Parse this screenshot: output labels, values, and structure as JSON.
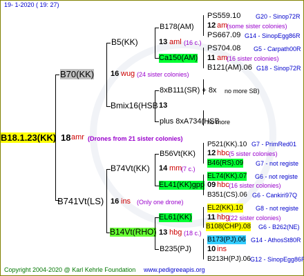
{
  "header": {
    "date": "19-  1-2020  ( 19:  27)"
  },
  "root": {
    "label": "B18.1.23(KK)",
    "num": "18",
    "src": "amr",
    "note": "(Drones from 21 sister colonies)"
  },
  "g1": [
    {
      "label": "B70(KK)",
      "num": "16",
      "src": "wug",
      "note": "(24 sister colonies)"
    },
    {
      "label": "B741Vt(LS)",
      "num": "16",
      "src": "ins",
      "note": "(Only one drone)"
    }
  ],
  "g2": [
    {
      "label": "B5(KK)",
      "num": "13",
      "src": "aml",
      "note": "(16 c.)"
    },
    {
      "label": "Bmix16(HSB",
      "num": "13",
      "src": "",
      "note": ""
    },
    {
      "label": "B74Vt(KK)",
      "num": "14",
      "src": "mm",
      "note": "(7 c.)"
    },
    {
      "label": "B14Vt(RHO)",
      "num": "13",
      "src": "hbg",
      "note": "(18 c.)"
    }
  ],
  "g3": [
    {
      "label": "B178(AM)"
    },
    {
      "label": "Ca150(AM)"
    },
    {
      "label": "8xB111(SR) + 8x",
      "extra": "no more SB)"
    },
    {
      "label": "plus 8xA734(HSB",
      "extra": "no more"
    },
    {
      "label": "B56Vt(KK)"
    },
    {
      "label": "EL41(KK)gpp"
    },
    {
      "label": "EL61(KK)"
    },
    {
      "label": "B235(PJ)"
    }
  ],
  "g4": [
    {
      "label": "PS559.10",
      "info": "G20 - Sinop72R"
    },
    {
      "num": "12",
      "src": "am",
      "note": "(some sister colonies)"
    },
    {
      "label": "PS667.09",
      "info": "G14 - SinopEgg86R"
    },
    {
      "label": "PS704.08",
      "info": "G5 - Carpath00R"
    },
    {
      "num": "11",
      "src": "am",
      "note": "(16 sister colonies)"
    },
    {
      "label": "B121(AM).06",
      "info": "G18 - Sinop72R"
    },
    {
      "label": "P521(KK).10",
      "info": "G7 - PrimRed01"
    },
    {
      "num": "12",
      "src": "hbc",
      "note": "(5 sister colonies)"
    },
    {
      "label": "B46(RS).09",
      "info": "G7 - not registe"
    },
    {
      "label": "EL74(KK).07",
      "info": "G6 - not registe"
    },
    {
      "num": "09",
      "src": "hbc",
      "note": "(16 sister colonies)"
    },
    {
      "label": "B351(CS).06",
      "info": "G6 - Cankiri97Q"
    },
    {
      "label": "EL2(KK).10",
      "info": "G8 - not registe"
    },
    {
      "num": "11",
      "src": "hbg",
      "note": "(22 sister colonies)"
    },
    {
      "label": "B108(CHP).08",
      "info": "G6 - B262(NE)"
    },
    {
      "label": "B173(PJ).06",
      "info": "G14 - AthosSt80R"
    },
    {
      "num": "10",
      "src": "ins",
      "note": ""
    },
    {
      "label": "B213H(PJ).06",
      "info": "G12 - SinopEgg86R"
    }
  ],
  "footer": {
    "copyright": "Copyright 2004-2020 @ Karl Kehrle Foundation",
    "site": "www.pedigreeapis.org"
  }
}
